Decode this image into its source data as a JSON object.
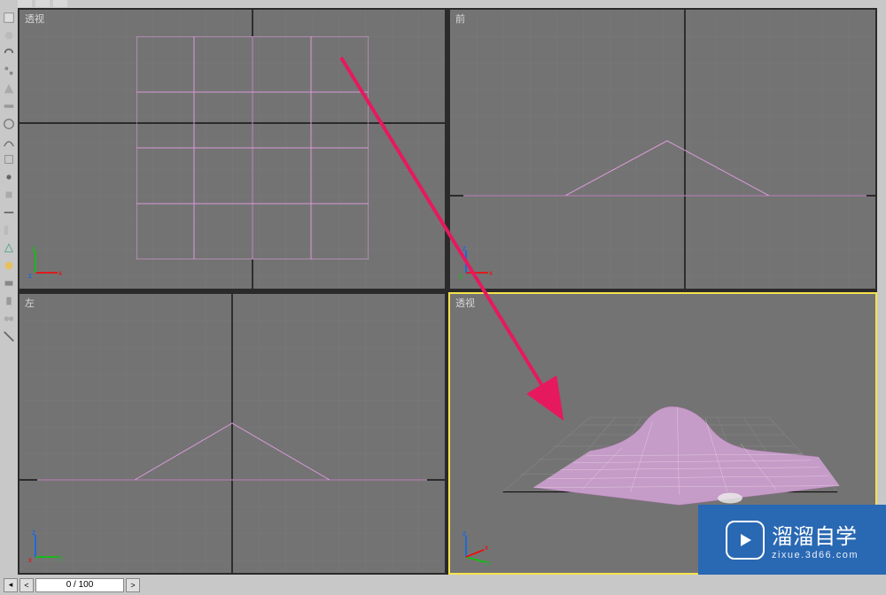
{
  "viewports": {
    "top_left": {
      "label": "透视"
    },
    "top_right": {
      "label": "前"
    },
    "bottom_left": {
      "label": "左"
    },
    "bottom_right": {
      "label": "透视"
    }
  },
  "axes": {
    "x": "x",
    "y": "y",
    "z": "z"
  },
  "timeline": {
    "frame_display": "0 / 100"
  },
  "watermark": {
    "brand": "溜溜自学",
    "domain": "zixue.3d66.com"
  },
  "colors": {
    "grid_major": "#5a5a5a",
    "grid_minor": "#6a6a6a",
    "axis_black": "#000000",
    "wireframe": "#d89ad8",
    "active_border": "#f6e24c",
    "arrow": "#e91e63",
    "mesh_fill": "#c99cc9"
  }
}
